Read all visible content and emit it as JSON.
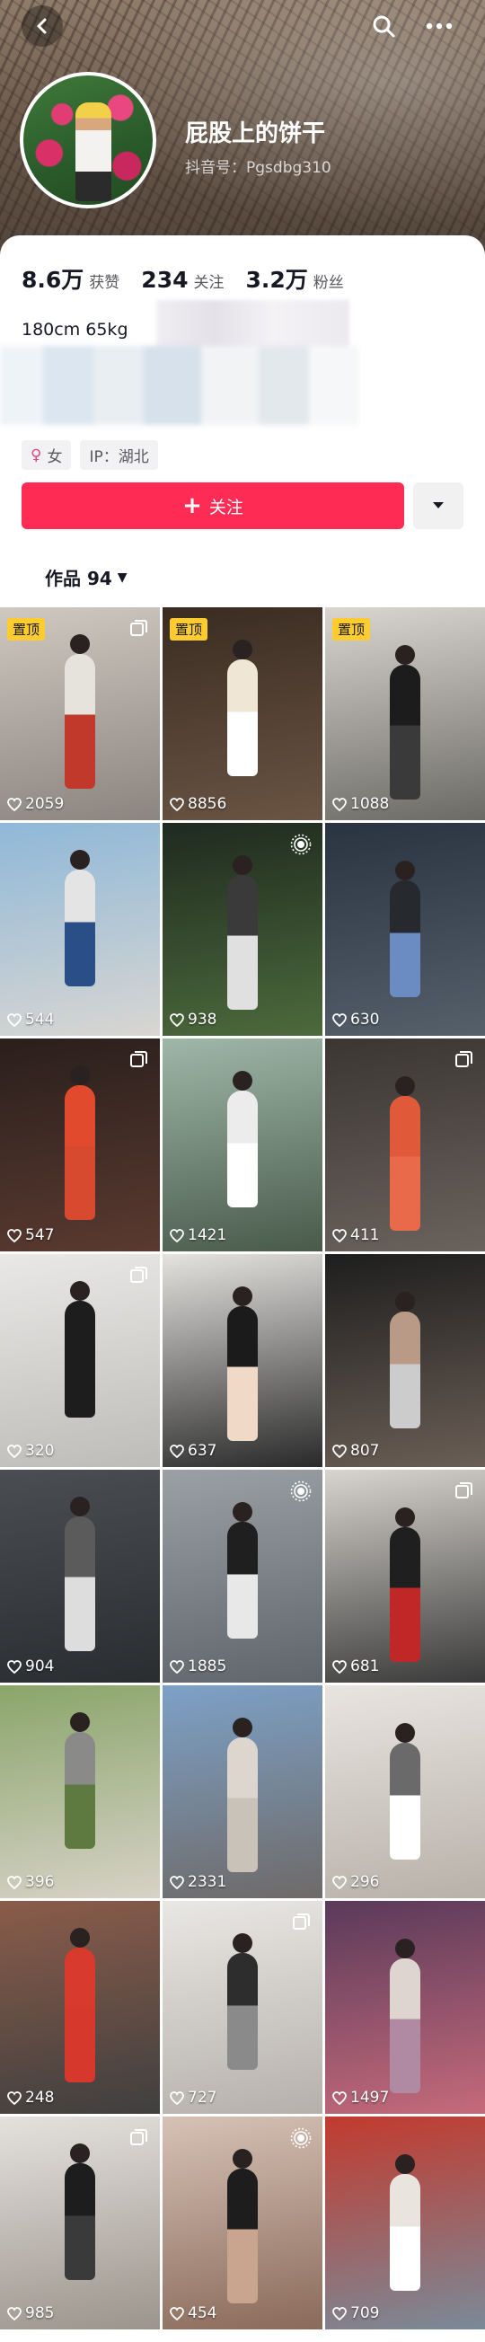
{
  "profile": {
    "name": "屁股上的饼干",
    "douyin_id": "抖音号：Pgsdbg310",
    "stats": [
      {
        "num": "8.6万",
        "label": "获赞"
      },
      {
        "num": "234",
        "label": "关注"
      },
      {
        "num": "3.2万",
        "label": "粉丝"
      }
    ],
    "bio": "180cm 65kg",
    "tags": [
      {
        "symbol": "♀",
        "text": "女"
      },
      {
        "symbol": "",
        "text": "IP：湖北"
      }
    ],
    "follow_label": "关注",
    "works_label": "作品 94"
  },
  "icons": {
    "back": "chevron-left-icon",
    "search": "search-icon",
    "more": "more-icon",
    "dropdown": "caret-down-icon",
    "like": "heart-icon",
    "multi": "multi-image-icon",
    "live": "live-photo-icon"
  },
  "colors": {
    "accent": "#fe2c55",
    "pin_badge": "#fecc2f"
  },
  "grid": [
    {
      "likes": "2059",
      "pinned": "置顶",
      "badge": "multi",
      "bg": [
        "#cfc8c0",
        "#8b8580"
      ],
      "fig": "#e6e2dc",
      "accent": "#c0392b"
    },
    {
      "likes": "8856",
      "pinned": "置顶",
      "badge": "",
      "bg": [
        "#3a2c22",
        "#6a5443"
      ],
      "fig": "#efe6d5",
      "accent": "#ffffff"
    },
    {
      "likes": "1088",
      "pinned": "置顶",
      "badge": "",
      "bg": [
        "#d9d6d0",
        "#6c6a64"
      ],
      "fig": "#1c1c1c",
      "accent": "#3a3a3a"
    },
    {
      "likes": "544",
      "pinned": "",
      "badge": "",
      "bg": [
        "#8fb8d8",
        "#d8d6d2"
      ],
      "fig": "#e4e4e4",
      "accent": "#2a4f86"
    },
    {
      "likes": "938",
      "pinned": "",
      "badge": "live",
      "bg": [
        "#1f2a1f",
        "#4c6a3c"
      ],
      "fig": "#3a3a3a",
      "accent": "#e0e0e0"
    },
    {
      "likes": "630",
      "pinned": "",
      "badge": "",
      "bg": [
        "#2a3340",
        "#55606b"
      ],
      "fig": "#26292e",
      "accent": "#6b8cc2"
    },
    {
      "likes": "547",
      "pinned": "",
      "badge": "multi",
      "bg": [
        "#2a1f1c",
        "#5a3a30"
      ],
      "fig": "#e24a2e",
      "accent": "#d84a30"
    },
    {
      "likes": "1421",
      "pinned": "",
      "badge": "",
      "bg": [
        "#9fb7a8",
        "#495a4a"
      ],
      "fig": "#ececec",
      "accent": "#ffffff"
    },
    {
      "likes": "411",
      "pinned": "",
      "badge": "multi",
      "bg": [
        "#3b3633",
        "#6a625c"
      ],
      "fig": "#e05a3a",
      "accent": "#e86a4a"
    },
    {
      "likes": "320",
      "pinned": "",
      "badge": "multi",
      "bg": [
        "#e9e8e6",
        "#bdbcb9"
      ],
      "fig": "#1d1d1d",
      "accent": "#1d1d1d"
    },
    {
      "likes": "637",
      "pinned": "",
      "badge": "",
      "bg": [
        "#e5e3e0",
        "#2a2a2a"
      ],
      "fig": "#1b1b1b",
      "accent": "#f1d9c8"
    },
    {
      "likes": "807",
      "pinned": "",
      "badge": "",
      "bg": [
        "#1e1e1e",
        "#6a5e55"
      ],
      "fig": "#b89a86",
      "accent": "#cccccc"
    },
    {
      "likes": "904",
      "pinned": "",
      "badge": "",
      "bg": [
        "#4a4e52",
        "#2a2d30"
      ],
      "fig": "#5b5b5b",
      "accent": "#dddddd"
    },
    {
      "likes": "1885",
      "pinned": "",
      "badge": "live",
      "bg": [
        "#9aa0a4",
        "#5f666b"
      ],
      "fig": "#1f1f1f",
      "accent": "#e8e8e8"
    },
    {
      "likes": "681",
      "pinned": "",
      "badge": "multi",
      "bg": [
        "#d8d4ce",
        "#3a3a3a"
      ],
      "fig": "#1f1f1f",
      "accent": "#c02828"
    },
    {
      "likes": "396",
      "pinned": "",
      "badge": "",
      "bg": [
        "#8aa56a",
        "#d7d2c7"
      ],
      "fig": "#8a8a88",
      "accent": "#5e7a40"
    },
    {
      "likes": "2331",
      "pinned": "",
      "badge": "",
      "bg": [
        "#7da1c7",
        "#6e6a68"
      ],
      "fig": "#dcd6cf",
      "accent": "#c9c2b8"
    },
    {
      "likes": "296",
      "pinned": "",
      "badge": "",
      "bg": [
        "#e8e4df",
        "#b7b1a9"
      ],
      "fig": "#6a6a6a",
      "accent": "#ffffff"
    },
    {
      "likes": "248",
      "pinned": "",
      "badge": "",
      "bg": [
        "#8a5c4a",
        "#3f3f3f"
      ],
      "fig": "#d93a2e",
      "accent": "#d6382c"
    },
    {
      "likes": "727",
      "pinned": "",
      "badge": "multi",
      "bg": [
        "#e9e7e4",
        "#b5b0aa"
      ],
      "fig": "#2d2d2d",
      "accent": "#8a8a8a"
    },
    {
      "likes": "1497",
      "pinned": "",
      "badge": "",
      "bg": [
        "#5a3a5a",
        "#c56a7a"
      ],
      "fig": "#ded4d0",
      "accent": "#b08aa2"
    },
    {
      "likes": "985",
      "pinned": "",
      "badge": "multi",
      "bg": [
        "#e4e1dd",
        "#9c948c"
      ],
      "fig": "#1d1d1d",
      "accent": "#3a3a3a"
    },
    {
      "likes": "454",
      "pinned": "",
      "badge": "live",
      "bg": [
        "#d6c2b5",
        "#8a6a5a"
      ],
      "fig": "#1d1d1d",
      "accent": "#c9a48e"
    },
    {
      "likes": "709",
      "pinned": "",
      "badge": "",
      "bg": [
        "#c23a2e",
        "#7a8a98"
      ],
      "fig": "#e9e4de",
      "accent": "#ffffff"
    }
  ]
}
